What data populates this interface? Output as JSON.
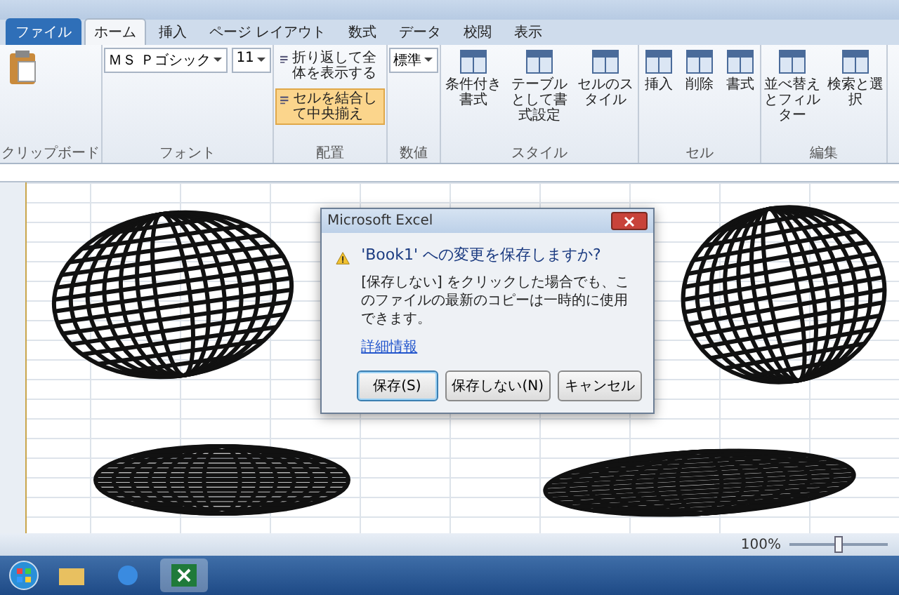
{
  "ribbon": {
    "tabs": [
      {
        "label": "ファイル",
        "selected": false
      },
      {
        "label": "ホーム",
        "selected": true
      },
      {
        "label": "挿入",
        "selected": false
      },
      {
        "label": "ページ レイアウト",
        "selected": false
      },
      {
        "label": "数式",
        "selected": false
      },
      {
        "label": "データ",
        "selected": false
      },
      {
        "label": "校閲",
        "selected": false
      },
      {
        "label": "表示",
        "selected": false
      }
    ],
    "groups": [
      {
        "label": "クリップボード",
        "controls": [
          {
            "kind": "paste"
          }
        ]
      },
      {
        "label": "フォント",
        "controls": [
          {
            "kind": "dropdown",
            "value": "ＭＳ Ｐゴシック"
          },
          {
            "kind": "dropdown",
            "value": "11"
          }
        ]
      },
      {
        "label": "配置",
        "controls": [
          {
            "kind": "small",
            "label": "折り返して全体を表示する",
            "selected": false
          },
          {
            "kind": "small",
            "label": "セルを結合して中央揃え",
            "selected": true
          }
        ]
      },
      {
        "label": "数値",
        "controls": [
          {
            "kind": "dropdown",
            "value": "標準"
          }
        ]
      },
      {
        "label": "スタイル",
        "controls": [
          {
            "kind": "large",
            "label": "条件付き書式"
          },
          {
            "kind": "large",
            "label": "テーブルとして書式設定"
          },
          {
            "kind": "large",
            "label": "セルのスタイル"
          }
        ]
      },
      {
        "label": "セル",
        "controls": [
          {
            "kind": "large",
            "label": "挿入"
          },
          {
            "kind": "large",
            "label": "削除"
          },
          {
            "kind": "large",
            "label": "書式"
          }
        ]
      },
      {
        "label": "編集",
        "controls": [
          {
            "kind": "large",
            "label": "並べ替えとフィルター"
          },
          {
            "kind": "large",
            "label": "検索と選択"
          }
        ]
      }
    ]
  },
  "dialog": {
    "title": "Microsoft Excel",
    "message": "'Book1' への変更を保存しますか?",
    "detail": "[保存しない] をクリックした場合でも、このファイルの最新のコピーは一時的に使用できます。",
    "link": "詳細情報",
    "buttons": [
      {
        "label": "保存(S)",
        "selected": true
      },
      {
        "label": "保存しない(N)",
        "selected": false
      },
      {
        "label": "キャンセル",
        "selected": false
      }
    ]
  },
  "status_bar": {
    "zoom": "100%",
    "level": 0.5
  }
}
